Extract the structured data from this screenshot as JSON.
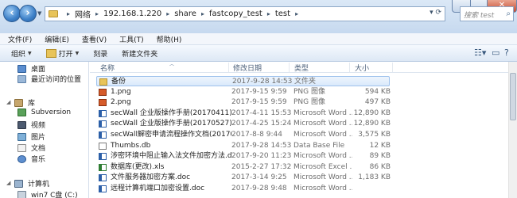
{
  "address": {
    "crumbs": [
      "网络",
      "192.168.1.220",
      "share",
      "fastcopy_test",
      "test"
    ],
    "search_placeholder": "搜索 test"
  },
  "menu": [
    "文件(F)",
    "编辑(E)",
    "查看(V)",
    "工具(T)",
    "帮助(H)"
  ],
  "commands": {
    "organize": "组织",
    "open": "打开",
    "burn": "刻录",
    "new_folder": "新建文件夹"
  },
  "nav": {
    "favorites": [
      "桌面",
      "最近访问的位置"
    ],
    "library": "库",
    "library_items": [
      "Subversion",
      "视频",
      "图片",
      "文档",
      "音乐"
    ],
    "computer": "计算机",
    "drives": [
      "win7 C盘 (C:)"
    ]
  },
  "columns": {
    "name": "名称",
    "date": "修改日期",
    "type": "类型",
    "size": "大小"
  },
  "files": [
    {
      "name": "备份",
      "date": "2017-9-28 14:53",
      "type": "文件夹",
      "size": "",
      "icon": "folder-icon",
      "selected": true
    },
    {
      "name": "1.png",
      "date": "2017-9-15 9:59",
      "type": "PNG 图像",
      "size": "594 KB",
      "icon": "png-icon"
    },
    {
      "name": "2.png",
      "date": "2017-9-15 9:59",
      "type": "PNG 图像",
      "size": "497 KB",
      "icon": "png-icon"
    },
    {
      "name": "secWall 企业版操作手册(20170411).doc",
      "date": "2017-4-11 15:53",
      "type": "Microsoft Word ...",
      "size": "12,890 KB",
      "icon": "word-doc-icon"
    },
    {
      "name": "secWall 企业版操作手册(20170527).doc",
      "date": "2017-4-25 15:24",
      "type": "Microsoft Word ...",
      "size": "12,890 KB",
      "icon": "word-doc-icon"
    },
    {
      "name": "secWall解密申请流程操作文档(2017012...",
      "date": "2017-8-8 9:44",
      "type": "Microsoft Word ...",
      "size": "3,575 KB",
      "icon": "word-doc-icon"
    },
    {
      "name": "Thumbs.db",
      "date": "2017-9-28 14:53",
      "type": "Data Base File",
      "size": "12 KB",
      "icon": "db-file-icon"
    },
    {
      "name": "涉密环境中阻止输入法文件加密方法.docx",
      "date": "2017-9-20 11:23",
      "type": "Microsoft Word ...",
      "size": "89 KB",
      "icon": "word-doc-icon"
    },
    {
      "name": "数据库(更改).xls",
      "date": "2015-2-27 17:32",
      "type": "Microsoft Excel ...",
      "size": "86 KB",
      "icon": "excel-icon"
    },
    {
      "name": "文件服务器加密方案.doc",
      "date": "2017-3-14 9:25",
      "type": "Microsoft Word ...",
      "size": "1,183 KB",
      "icon": "word-doc-icon"
    },
    {
      "name": "远程计算机端口加密设置.doc",
      "date": "2017-9-28 9:48",
      "type": "Microsoft Word ...",
      "size": "",
      "icon": "word-doc-icon"
    }
  ]
}
